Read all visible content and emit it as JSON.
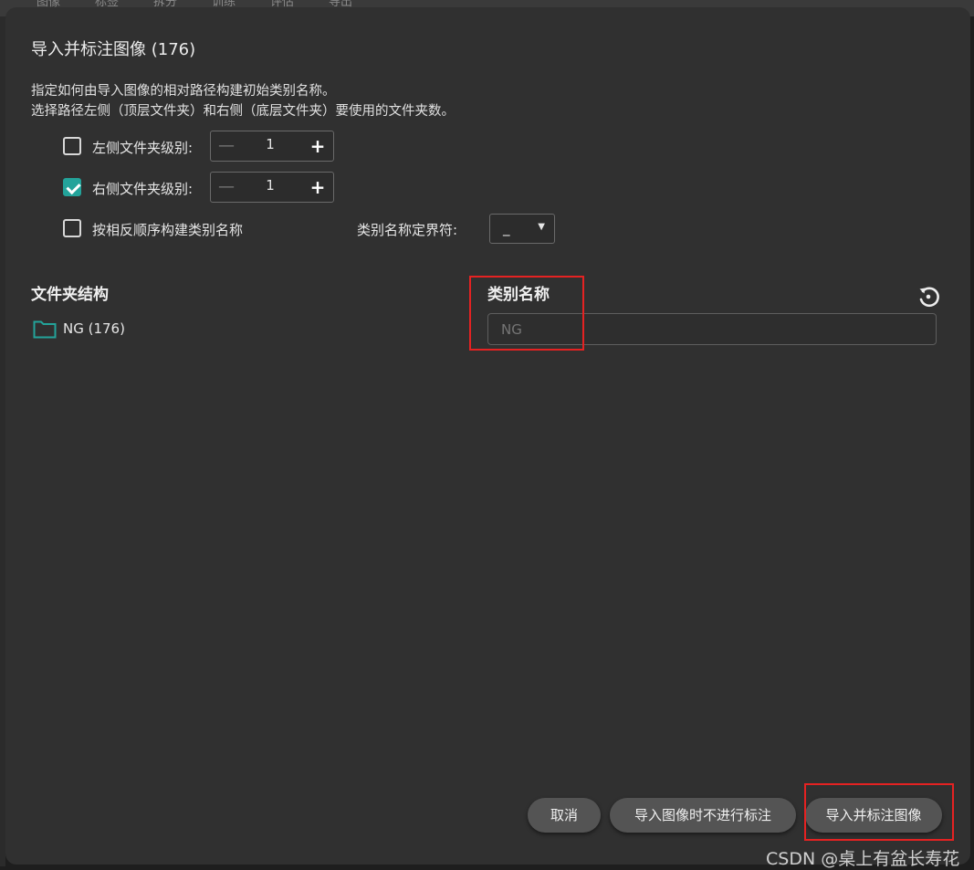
{
  "background_tabs": [
    "图像",
    "标签",
    "拆分",
    "训练",
    "评估",
    "导出"
  ],
  "dialog": {
    "title": "导入并标注图像 (176)",
    "description_line1": "指定如何由导入图像的相对路径构建初始类别名称。",
    "description_line2": "选择路径左侧（顶层文件夹）和右侧（底层文件夹）要使用的文件夹数。"
  },
  "options": {
    "left_level": {
      "label": "左侧文件夹级别:",
      "checked": false,
      "value": "1",
      "minus": "—",
      "plus": "+"
    },
    "right_level": {
      "label": "右侧文件夹级别:",
      "checked": true,
      "value": "1",
      "minus": "—",
      "plus": "+"
    },
    "reverse_order": {
      "label": "按相反顺序构建类别名称",
      "checked": false
    },
    "delimiter": {
      "label": "类别名称定界符:",
      "value": "_",
      "arrow": "▼"
    }
  },
  "folder_structure": {
    "heading": "文件夹结构",
    "items": [
      {
        "label": "NG (176)",
        "icon": "folder-icon"
      }
    ]
  },
  "class_names": {
    "heading": "类别名称",
    "items": [
      {
        "placeholder": "NG"
      }
    ]
  },
  "buttons": {
    "cancel": "取消",
    "import_no_label": "导入图像时不进行标注",
    "import_and_label": "导入并标注图像"
  },
  "watermark": "CSDN @桌上有盆长寿花",
  "colors": {
    "accent": "#23a39a",
    "dialog_bg": "#303030",
    "button_bg": "#545454",
    "highlight": "#e52222"
  }
}
